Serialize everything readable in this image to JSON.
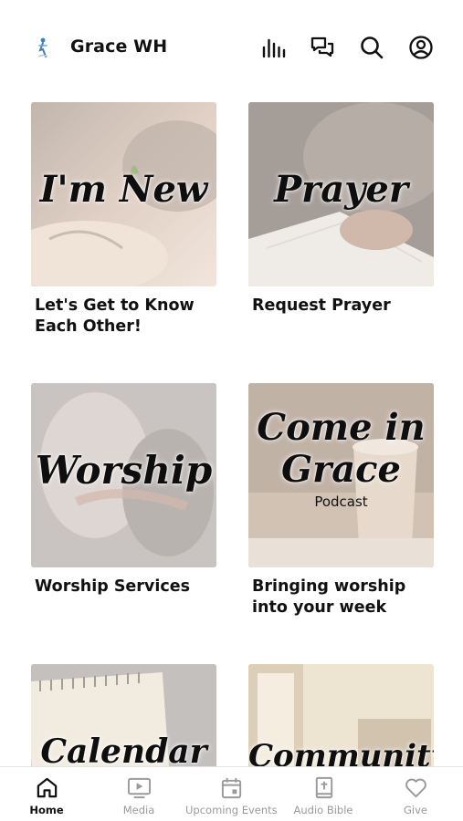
{
  "header": {
    "app_title": "Grace WH",
    "icons": [
      "audio-bars-icon",
      "chat-icon",
      "search-icon",
      "profile-icon"
    ]
  },
  "cards": [
    {
      "tile_title": "I'm New",
      "caption": "Let's Get to Know Each Other!"
    },
    {
      "tile_title": "Prayer",
      "caption": "Request Prayer"
    },
    {
      "tile_title": "Worship",
      "caption": "Worship Services"
    },
    {
      "tile_title_line1": "Come in",
      "tile_title_line2": "Grace",
      "tile_subtitle": "Podcast",
      "caption": "Bringing worship into your week"
    },
    {
      "tile_title": "Calendar"
    },
    {
      "tile_title": "Community"
    }
  ],
  "tabbar": {
    "active": "Home",
    "tabs": [
      {
        "label": "Home",
        "icon": "home-icon"
      },
      {
        "label": "Media",
        "icon": "play-screen-icon"
      },
      {
        "label": "Upcoming Events",
        "icon": "calendar-icon"
      },
      {
        "label": "Audio Bible",
        "icon": "bible-icon"
      },
      {
        "label": "Give",
        "icon": "heart-icon"
      }
    ]
  }
}
